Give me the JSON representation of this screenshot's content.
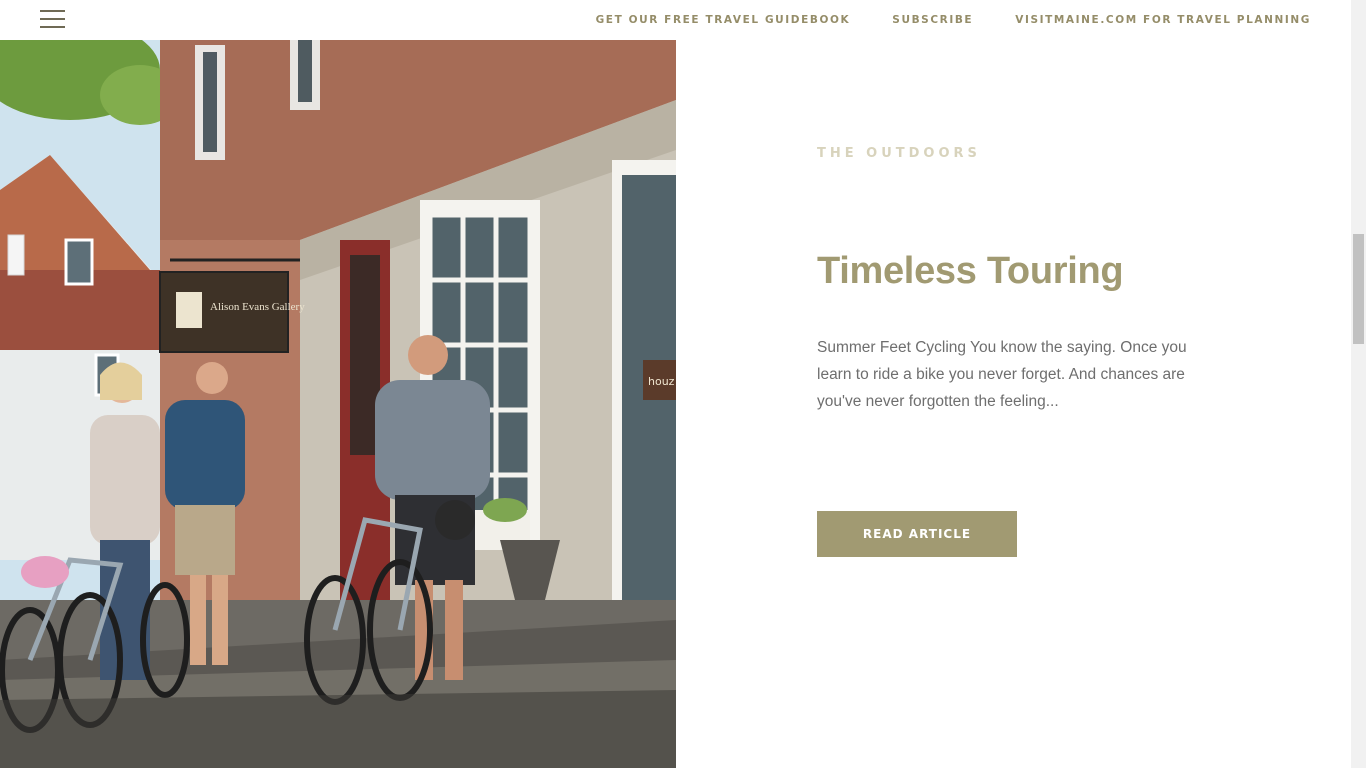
{
  "nav": {
    "menu_icon": "hamburger-menu-icon",
    "links": [
      "GET OUR FREE TRAVEL GUIDEBOOK",
      "SUBSCRIBE",
      "VISITMAINE.COM FOR TRAVEL PLANNING"
    ]
  },
  "photo": {
    "sign_text": "Alison Evans Gallery",
    "shop_sign_text": "houz"
  },
  "article": {
    "category": "THE OUTDOORS",
    "title": "Timeless Touring",
    "excerpt": "Summer Feet Cycling You know the saying. Once you learn to ride a bike you never forget. And chances are you've never forgotten the feeling...",
    "button_label": "READ ARTICLE"
  },
  "colors": {
    "accent": "#a19a72",
    "nav_text": "#958d69",
    "eyebrow": "#d8d3bc",
    "body_text": "#6e6e6e"
  }
}
